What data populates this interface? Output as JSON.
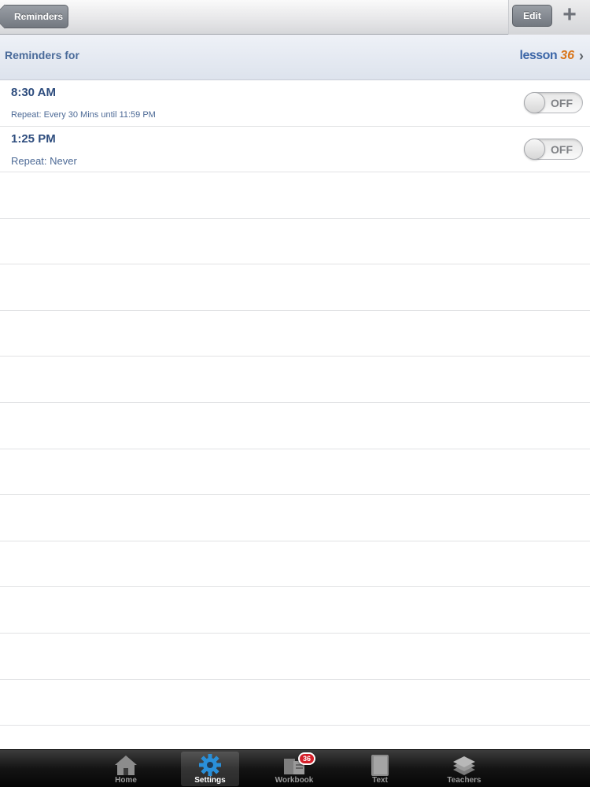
{
  "navbar": {
    "back_label": "Reminders",
    "edit_label": "Edit",
    "add_label": "+"
  },
  "section": {
    "title": "Reminders for",
    "lesson_word": "lesson",
    "lesson_number": "36",
    "chevron": "›"
  },
  "reminders": [
    {
      "time": "8:30 AM",
      "repeat": "Repeat: Every 30 Mins until 11:59 PM",
      "toggle": "OFF"
    },
    {
      "time": "1:25 PM",
      "repeat": "Repeat: Never",
      "toggle": "OFF"
    }
  ],
  "tabs": [
    {
      "label": "Home",
      "icon": "home-icon"
    },
    {
      "label": "Settings",
      "icon": "gear-icon",
      "active": true
    },
    {
      "label": "Workbook",
      "icon": "workbook-icon",
      "badge": "36"
    },
    {
      "label": "Text",
      "icon": "book-icon"
    },
    {
      "label": "Teachers",
      "icon": "teachers-stack-icon"
    }
  ],
  "colors": {
    "title_blue": "#4a6b9a",
    "time_blue": "#2e4d7e",
    "lesson_orange": "#d9761c",
    "active_tab_icon": "#2a8fd8",
    "badge_red": "#d5202a"
  }
}
